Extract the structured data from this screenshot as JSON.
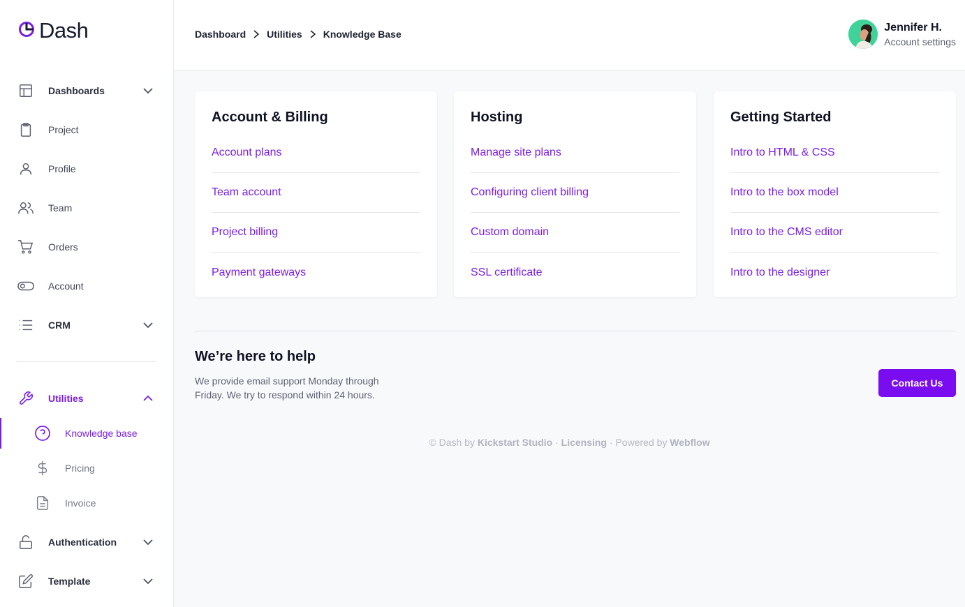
{
  "app": {
    "name": "Dash"
  },
  "colors": {
    "accent": "#7a1de6",
    "button": "#7a0cf0",
    "text": "#0f1222"
  },
  "sidebar": {
    "items": [
      {
        "label": "Dashboards",
        "icon": "layout-icon",
        "has_chevron": true
      },
      {
        "label": "Project",
        "icon": "clipboard-icon"
      },
      {
        "label": "Profile",
        "icon": "user-icon"
      },
      {
        "label": "Team",
        "icon": "users-icon"
      },
      {
        "label": "Orders",
        "icon": "cart-icon"
      },
      {
        "label": "Account",
        "icon": "toggle-icon"
      },
      {
        "label": "CRM",
        "icon": "list-icon",
        "has_chevron": true
      }
    ],
    "utilities": {
      "label": "Utilities",
      "icon": "wrench-icon",
      "expanded": true,
      "children": [
        {
          "label": "Knowledge base",
          "icon": "help-circle-icon",
          "active": true
        },
        {
          "label": "Pricing",
          "icon": "dollar-icon"
        },
        {
          "label": "Invoice",
          "icon": "file-text-icon"
        }
      ]
    },
    "bottom_items": [
      {
        "label": "Authentication",
        "icon": "unlock-icon",
        "has_chevron": true
      },
      {
        "label": "Template",
        "icon": "edit-icon",
        "has_chevron": true
      }
    ]
  },
  "header": {
    "breadcrumb": [
      "Dashboard",
      "Utilities",
      "Knowledge Base"
    ],
    "user": {
      "name": "Jennifer H.",
      "subtitle": "Account settings"
    }
  },
  "cards": [
    {
      "title": "Account & Billing",
      "links": [
        "Account plans",
        "Team account",
        "Project billing",
        "Payment gateways"
      ]
    },
    {
      "title": "Hosting",
      "links": [
        "Manage site plans",
        "Configuring client billing",
        "Custom domain",
        "SSL certificate"
      ]
    },
    {
      "title": "Getting Started",
      "links": [
        "Intro to HTML & CSS",
        "Intro to the box model",
        "Intro to the CMS editor",
        "Intro to the designer"
      ]
    }
  ],
  "help": {
    "title": "We’re here to help",
    "text": "We provide email support Monday through Friday. We try to respond within 24 hours.",
    "button": "Contact Us"
  },
  "footer": {
    "prefix": "© Dash by",
    "studio": "Kickstart Studio",
    "dot1": " · ",
    "licensing": "Licensing",
    "dot2": " · Powered by ",
    "platform": "Webflow"
  }
}
